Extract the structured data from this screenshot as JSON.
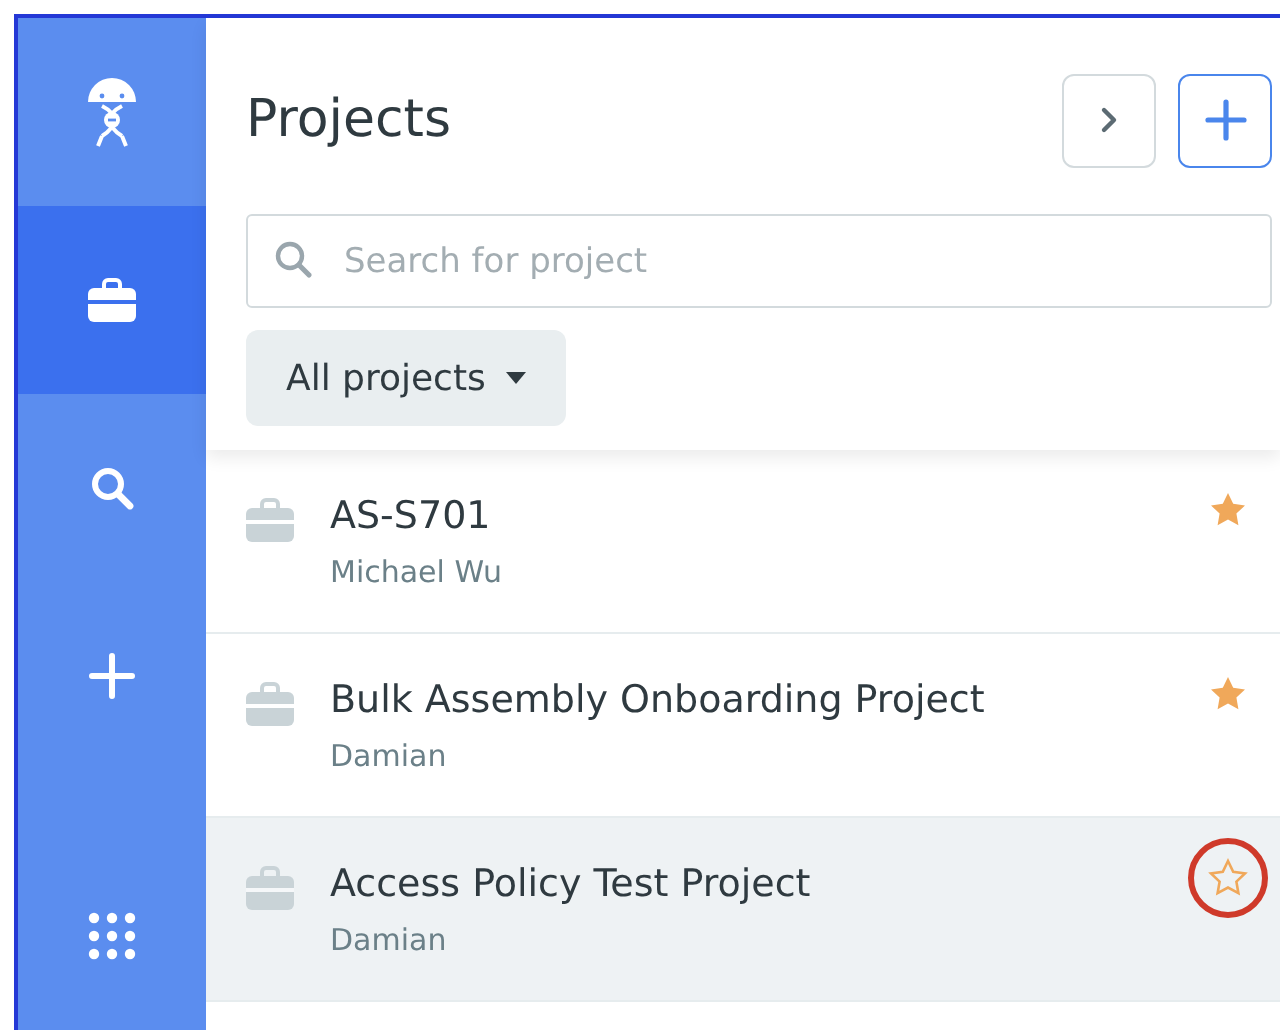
{
  "sidebar": {
    "items": [
      {
        "kind": "logo",
        "selected": false
      },
      {
        "kind": "projects",
        "selected": true
      },
      {
        "kind": "search",
        "selected": false
      },
      {
        "kind": "add",
        "selected": false
      },
      {
        "kind": "apps",
        "selected": false
      }
    ]
  },
  "header": {
    "title": "Projects",
    "search": {
      "placeholder": "Search for project"
    },
    "filter": {
      "label": "All projects"
    }
  },
  "projects": [
    {
      "name": "AS-S701",
      "owner": "Michael Wu",
      "starred": true,
      "selected": false,
      "circled": false
    },
    {
      "name": "Bulk Assembly Onboarding Project",
      "owner": "Damian",
      "starred": true,
      "selected": false,
      "circled": false
    },
    {
      "name": "Access Policy Test Project",
      "owner": "Damian",
      "starred": false,
      "selected": true,
      "circled": true
    }
  ]
}
